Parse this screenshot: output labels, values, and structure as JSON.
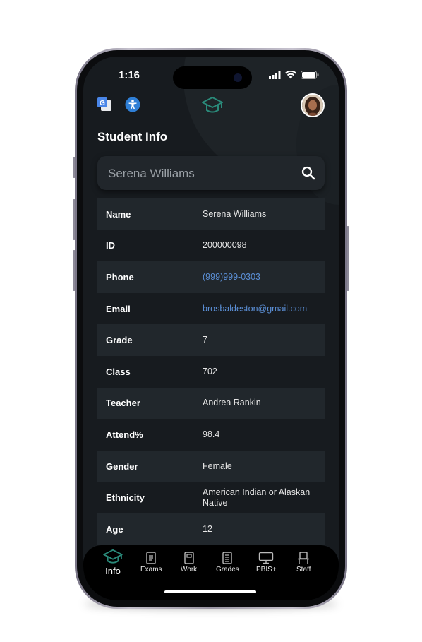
{
  "status": {
    "time": "1:16"
  },
  "header": {
    "title": "Student Info"
  },
  "search": {
    "value": "Serena Williams"
  },
  "rows": [
    {
      "label": "Name",
      "value": "Serena Williams"
    },
    {
      "label": "ID",
      "value": "200000098"
    },
    {
      "label": "Phone",
      "value": "(999)999-0303"
    },
    {
      "label": "Email",
      "value": "brosbaldeston@gmail.com"
    },
    {
      "label": "Grade",
      "value": "7"
    },
    {
      "label": "Class",
      "value": "702"
    },
    {
      "label": "Teacher",
      "value": "Andrea Rankin"
    },
    {
      "label": "Attend%",
      "value": "98.4"
    },
    {
      "label": "Gender",
      "value": "Female"
    },
    {
      "label": "Ethnicity",
      "value": "American Indian or Alaskan Native"
    },
    {
      "label": "Age",
      "value": "12"
    }
  ],
  "tabs": [
    {
      "label": "Info",
      "icon": "graduation-cap-icon"
    },
    {
      "label": "Exams",
      "icon": "exams-icon"
    },
    {
      "label": "Work",
      "icon": "work-icon"
    },
    {
      "label": "Grades",
      "icon": "grades-icon"
    },
    {
      "label": "PBIS+",
      "icon": "pbis-icon"
    },
    {
      "label": "Staff",
      "icon": "staff-icon"
    }
  ],
  "colors": {
    "accent": "#2a8a7a",
    "link": "#5b8fd6",
    "background": "#171b1f"
  }
}
